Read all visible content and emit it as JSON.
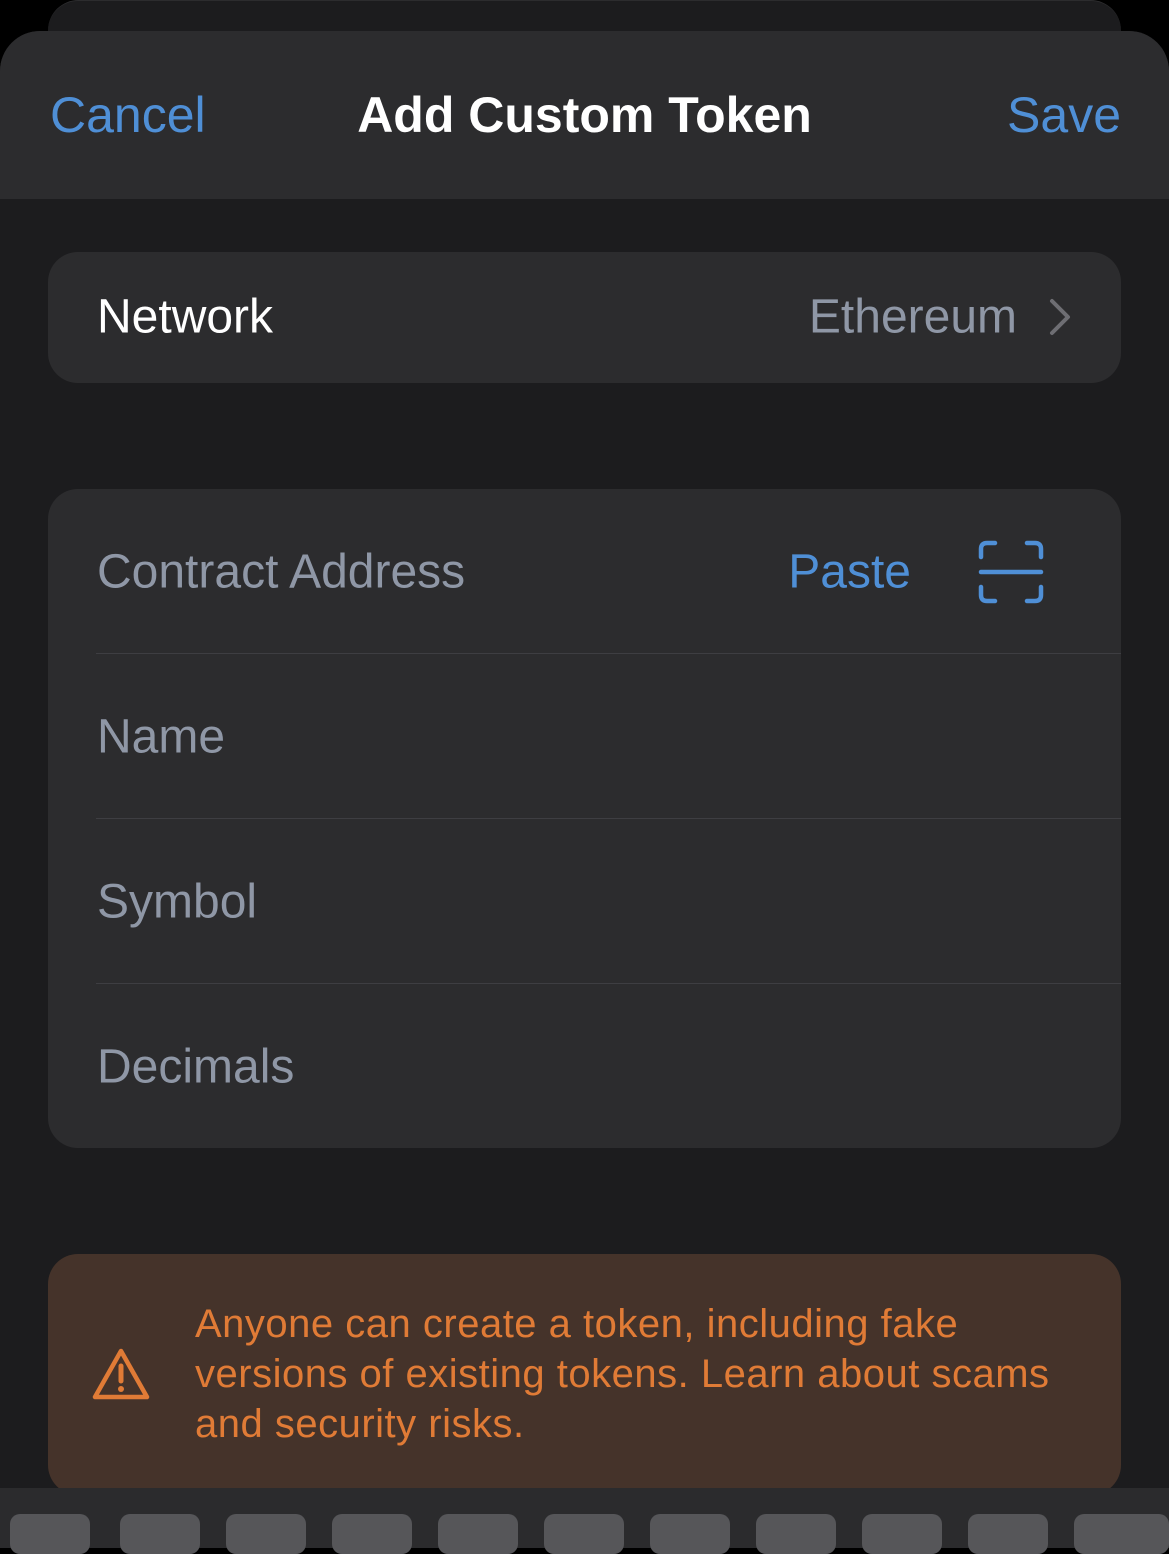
{
  "nav": {
    "cancel_label": "Cancel",
    "title": "Add Custom Token",
    "save_label": "Save"
  },
  "network": {
    "label": "Network",
    "value": "Ethereum",
    "icon": "chevron-right-icon"
  },
  "fields": {
    "contract_address": {
      "placeholder": "Contract Address",
      "value": ""
    },
    "paste_label": "Paste",
    "scan_icon": "scan-icon",
    "name": {
      "placeholder": "Name",
      "value": ""
    },
    "symbol": {
      "placeholder": "Symbol",
      "value": ""
    },
    "decimals": {
      "placeholder": "Decimals",
      "value": ""
    }
  },
  "warning": {
    "icon": "warning-triangle-icon",
    "text": "Anyone can create a token, including fake versions of existing tokens. Learn about scams and security risks."
  },
  "colors": {
    "accent": "#4f8fd6",
    "warning": "#e07b36",
    "warning_background": "#45332a",
    "card_background": "#2c2c2e",
    "sheet_background": "#1c1c1e"
  }
}
